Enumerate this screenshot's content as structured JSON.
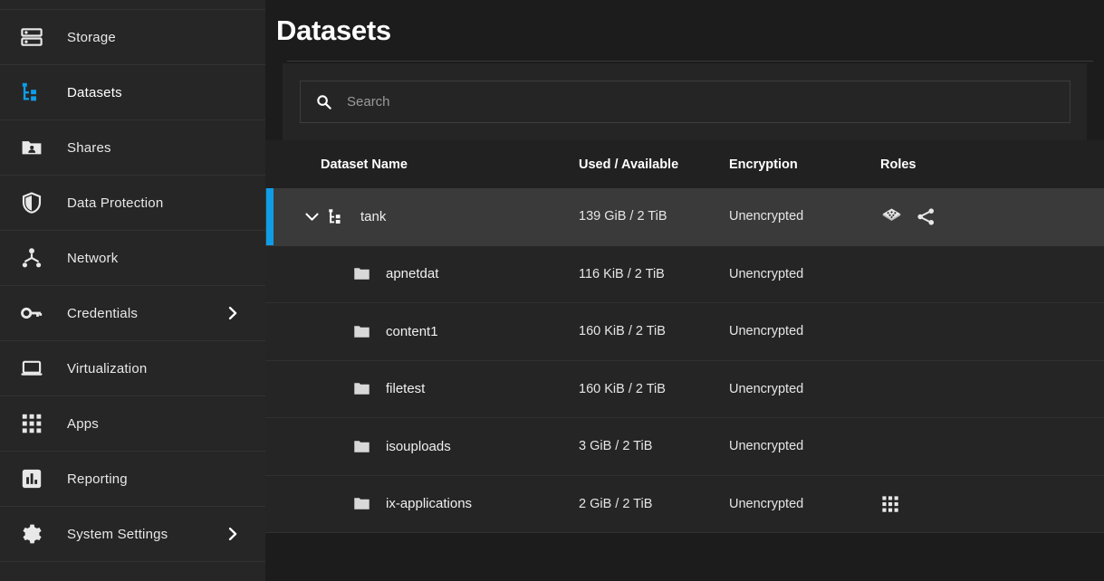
{
  "theme": {
    "accent": "#0f9de8",
    "sidebar_bg": "#262626",
    "page_bg": "#1c1c1c",
    "card_bg": "#252525",
    "row_selected_bg": "#3a3a3a",
    "text": "#e8e8e8"
  },
  "sidebar": {
    "items": [
      {
        "label": "Storage",
        "icon": "storage-icon",
        "active": false,
        "expandable": false
      },
      {
        "label": "Datasets",
        "icon": "datasets-tree-icon",
        "active": true,
        "expandable": false
      },
      {
        "label": "Shares",
        "icon": "shares-folder-icon",
        "active": false,
        "expandable": false
      },
      {
        "label": "Data Protection",
        "icon": "shield-icon",
        "active": false,
        "expandable": false
      },
      {
        "label": "Network",
        "icon": "network-icon",
        "active": false,
        "expandable": false
      },
      {
        "label": "Credentials",
        "icon": "key-icon",
        "active": false,
        "expandable": true
      },
      {
        "label": "Virtualization",
        "icon": "laptop-icon",
        "active": false,
        "expandable": false
      },
      {
        "label": "Apps",
        "icon": "apps-grid-icon",
        "active": false,
        "expandable": false
      },
      {
        "label": "Reporting",
        "icon": "reporting-chart-icon",
        "active": false,
        "expandable": false
      },
      {
        "label": "System Settings",
        "icon": "gear-icon",
        "active": false,
        "expandable": true
      }
    ]
  },
  "header": {
    "title": "Datasets"
  },
  "search": {
    "placeholder": "Search",
    "value": "",
    "icon": "search-icon"
  },
  "table": {
    "columns": [
      {
        "key": "name",
        "label": "Dataset Name"
      },
      {
        "key": "used",
        "label": "Used / Available"
      },
      {
        "key": "encryption",
        "label": "Encryption"
      },
      {
        "key": "roles",
        "label": "Roles"
      }
    ],
    "rows": [
      {
        "name": "tank",
        "used": "139 GiB / 2 TiB",
        "encryption": "Unencrypted",
        "roles": [
          "dataset-diamond-icon",
          "share-icon"
        ],
        "icon": "datasets-tree-icon",
        "level": 0,
        "selected": true,
        "expanded": true,
        "chevron": "chevron-down-icon"
      },
      {
        "name": "apnetdat",
        "used": "116 KiB / 2 TiB",
        "encryption": "Unencrypted",
        "roles": [],
        "icon": "folder-icon",
        "level": 1,
        "selected": false,
        "expanded": false,
        "chevron": ""
      },
      {
        "name": "content1",
        "used": "160 KiB / 2 TiB",
        "encryption": "Unencrypted",
        "roles": [],
        "icon": "folder-icon",
        "level": 1,
        "selected": false,
        "expanded": false,
        "chevron": ""
      },
      {
        "name": "filetest",
        "used": "160 KiB / 2 TiB",
        "encryption": "Unencrypted",
        "roles": [],
        "icon": "folder-icon",
        "level": 1,
        "selected": false,
        "expanded": false,
        "chevron": ""
      },
      {
        "name": "isouploads",
        "used": "3 GiB / 2 TiB",
        "encryption": "Unencrypted",
        "roles": [],
        "icon": "folder-icon",
        "level": 1,
        "selected": false,
        "expanded": false,
        "chevron": ""
      },
      {
        "name": "ix-applications",
        "used": "2 GiB / 2 TiB",
        "encryption": "Unencrypted",
        "roles": [
          "apps-grid-icon"
        ],
        "icon": "folder-icon",
        "level": 1,
        "selected": false,
        "expanded": false,
        "chevron": ""
      }
    ]
  }
}
